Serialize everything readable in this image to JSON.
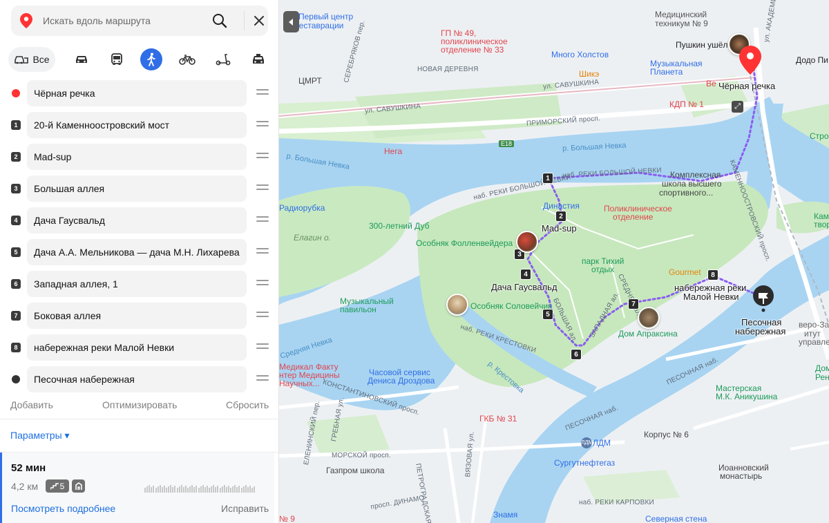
{
  "search": {
    "placeholder": "Искать вдоль маршрута"
  },
  "modes": {
    "all_label": "Все",
    "active": "pedestrian",
    "items": [
      "car",
      "transit",
      "pedestrian",
      "bicycle",
      "scooter",
      "taxi"
    ]
  },
  "waypoints": [
    {
      "marker": "",
      "label": "Чёрная речка"
    },
    {
      "marker": "1",
      "label": "20-й Каменноостровский мост"
    },
    {
      "marker": "2",
      "label": "Mad-sup"
    },
    {
      "marker": "3",
      "label": "Большая аллея"
    },
    {
      "marker": "4",
      "label": "Дача Гаусвальд"
    },
    {
      "marker": "5",
      "label": "Дача А.А. Мельникова — дача М.Н. Лихарева"
    },
    {
      "marker": "6",
      "label": "Западная аллея, 1"
    },
    {
      "marker": "7",
      "label": "Боковая аллея"
    },
    {
      "marker": "8",
      "label": "набережная реки Малой Невки"
    },
    {
      "marker": "",
      "label": "Песочная набережная"
    }
  ],
  "actions": {
    "add": "Добавить",
    "optimize": "Оптимизировать",
    "reset": "Сбросить"
  },
  "params_label": "Параметры ▾",
  "route": {
    "time": "52 мин",
    "distance": "4,2 км",
    "stairs_count": "5",
    "details_link": "Посмотреть подробнее",
    "fix_link": "Исправить"
  },
  "map": {
    "labels": {
      "first_center": "Первый центр",
      "restoration": "реставрации",
      "gp49": "ГП № 49,",
      "polyclinic": "поликлиническое",
      "dept33": "отделение № 33",
      "med_tech": "Медицинский",
      "tech9": "техникум № 9",
      "pushkin": "Пушкин ушёл",
      "dodo": "Додо Пи",
      "mnogo": "Много Холстов",
      "muz_planet": "Музыкальная",
      "planet": "Планета",
      "nov_derevnya": "НОВАЯ ДЕРЕВНЯ",
      "shike": "Шикэ",
      "tsmrt": "ЦМРТ",
      "savushkina1": "ул. САВУШКИНА",
      "savushkina2": "ул. САВУШКИНА",
      "vee": "Ве",
      "chernaya": "Чёрная речка",
      "kdp": "КДП № 1",
      "serebryakov": "СЕРЕБРЯКОВ пер.",
      "primorsky": "ПРИМОРСКИЙ просп.",
      "e18": "E18",
      "nega": "Нега",
      "strog": "Строга",
      "b_nevka1": "р. Большая Невка",
      "b_nevka2": "р. Большая Невка",
      "nab_bn1": "наб. РЕКИ БОЛЬШОЙ НЕВКИ",
      "nab_bn2": "наб. РЕКИ БОЛЬШОЙ НЕВКИ",
      "akad_krylova": "ул. АКАДЕМИКА КРЫЛОВА",
      "complex1": "Комплексная",
      "complex2": "школа высшего",
      "complex3": "спортивного...",
      "radiorubka": "Радиорубка",
      "dinastiya": "Династия",
      "poly_dept1": "Поликлиническое",
      "poly_dept2": "отделение",
      "kamen1": "Камен",
      "kamen2": "творе",
      "dub": "300-летний Дуб",
      "madsup": "Mad-sup",
      "elagin": "Елагин о.",
      "follen": "Особняк Фолленвейдера",
      "park1": "парк Тихий",
      "park2": "отдых",
      "kamennoostr": "КАМЕННООСТРОВСКИЙ просп.",
      "gauswald": "Дача Гаусвальд",
      "gourmet": "Gourmet",
      "nab_mn1": "набережная реки",
      "nab_mn2": "Малой Невки",
      "bolshaya_al": "БОЛЬШАЯ ал.",
      "zapadnaya_al": "ЗАПАДНАЯ ал.",
      "srednyaya": "СРЕДНЯЯ ал.",
      "muz_pav1": "Музыкальный",
      "muz_pav2": "павильон",
      "solov": "Особняк Соловейчик",
      "pesochnaya1": "Песочная",
      "pesochnaya2": "набережная",
      "institut1": "веро-Запа",
      "institut2": "итут",
      "institut3": "управления",
      "sr_nevka": "Средняя Невка",
      "nab_krest": "наб. РЕКИ КРЕСТОВКИ",
      "dom_aprak": "Дом Апраксина",
      "dom_r1": "Дом",
      "dom_r2": "Ренте",
      "medfact1": "Медикал Факту",
      "medfact2": "нтер Медицины",
      "medfact3": "Научных...",
      "chasovoy1": "Часовой сервис",
      "chasovoy2": "Дениса Дроздова",
      "krestovka": "р. Крестовка",
      "pesochnaya_nab1": "ПЕСОЧНАЯ наб.",
      "pesochnaya_nab2": "ПЕСОЧНАЯ наб.",
      "masterskaya1": "Мастерская",
      "masterskaya2": "М.К. Аникушина",
      "konst": "КОНСТАНТИНОВСКИЙ просп.",
      "gkb31": "ГКБ № 31",
      "elenin": "ЕЛЕНИНСКИЙ пер.",
      "grebnaya": "ГРЕБНАЯ ул.",
      "korpus6": "Корпус № 6",
      "morskoy": "МОРСКОЙ просп.",
      "ldm": "ЛДМ",
      "ldm_logo": "ЛДМ",
      "surgut": "Сургутнефтегаз",
      "ioann1": "Иоанновский",
      "ioann2": "монастырь",
      "gazprom": "Газпром школа",
      "petrograd": "ПЕТРОГРАДСКАЯ наб.",
      "vyazovaya": "ВЯЗОВАЯ ул.",
      "dinamo": "просп. ДИНАМО",
      "karpovka": "наб. РЕКИ КАРПОВКИ",
      "znamya": "Знамя",
      "sev_stena": "Северная стена",
      "n9": "№ 9"
    }
  },
  "colors": {
    "accent": "#2f6ee6",
    "route_dots": "#8a5cf0",
    "water": "#a8d4f2",
    "park": "#c9eac1",
    "marker_red": "#f33"
  }
}
